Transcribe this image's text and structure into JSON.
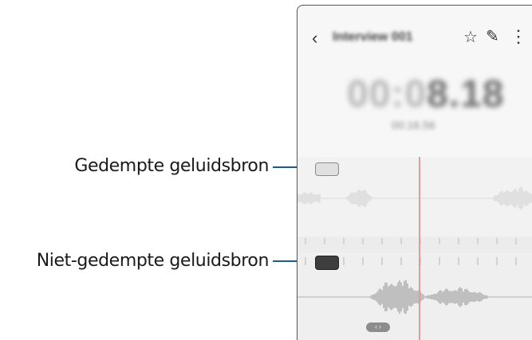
{
  "callouts": {
    "muted_source": "Gedempte geluidsbron",
    "unmuted_source": "Niet-gedempte geluidsbron"
  },
  "recorder": {
    "title": "Interview 001",
    "timer_dim": "00:0",
    "timer_bright": "8.18",
    "sub_time": "00:16.56"
  },
  "icons": {
    "back": "‹",
    "star": "☆",
    "edit": "✎",
    "more": "⋮",
    "handle": "‹ ›"
  },
  "colors": {
    "leader": "#1d5b8c",
    "playhead": "#e29a9a"
  }
}
